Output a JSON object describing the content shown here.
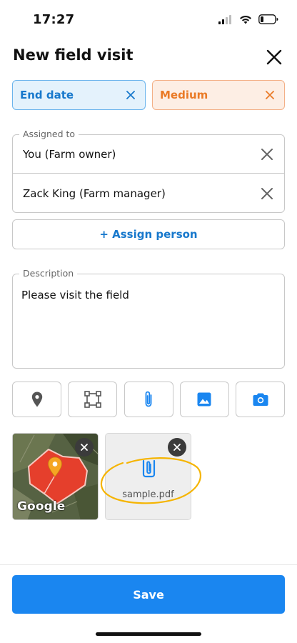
{
  "status_bar": {
    "time": "17:27",
    "icons": [
      "cellular-signal-icon",
      "wifi-icon",
      "battery-icon"
    ]
  },
  "header": {
    "title": "New field visit",
    "close_icon": "close-icon"
  },
  "chips": [
    {
      "label": "End date",
      "color": "#1778cc",
      "background": "#e4f2fc"
    },
    {
      "label": "Medium",
      "color": "#ea7a26",
      "background": "#fdeee4"
    }
  ],
  "assigned": {
    "legend": "Assigned to",
    "people": [
      "You (Farm owner)",
      "Zack King (Farm manager)"
    ]
  },
  "assign_button": "+ Assign person",
  "description": {
    "legend": "Description",
    "value": "Please visit the field"
  },
  "tools": [
    "location-pin-icon",
    "area-select-icon",
    "attachment-icon",
    "image-icon",
    "camera-icon"
  ],
  "attachments": {
    "map": {
      "label": "Google"
    },
    "file": {
      "name": "sample.pdf",
      "icon": "attachment-icon"
    }
  },
  "save_button": "Save",
  "colors": {
    "accent": "#1a86f0",
    "link": "#1778cc",
    "highlight": "#f5b400",
    "field": "#e53f2c"
  }
}
